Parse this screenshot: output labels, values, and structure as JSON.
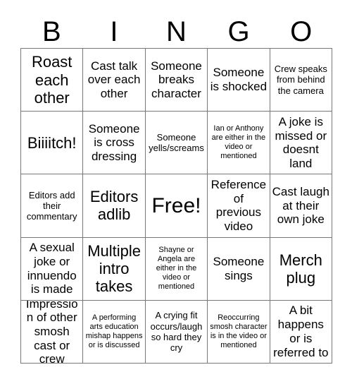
{
  "card": {
    "title": "BINGO",
    "header_letters": [
      "B",
      "I",
      "N",
      "G",
      "O"
    ],
    "columns": 5,
    "rows": 5,
    "border_color": "#777777",
    "text_color": "#000000",
    "background_color": "#ffffff",
    "free_space": {
      "row": 2,
      "col": 2,
      "label": "Free!"
    },
    "cells": [
      [
        {
          "text": "Roast each other",
          "size": "lg"
        },
        {
          "text": "Cast talk over each other",
          "size": "md"
        },
        {
          "text": "Someone breaks character",
          "size": "md"
        },
        {
          "text": "Someone is shocked",
          "size": "md"
        },
        {
          "text": "Crew speaks from behind the camera",
          "size": "sm"
        }
      ],
      [
        {
          "text": "Biiiitch!",
          "size": "lg"
        },
        {
          "text": "Someone is cross dressing",
          "size": "md"
        },
        {
          "text": "Someone yells/screams",
          "size": "sm"
        },
        {
          "text": "Ian or Anthony are either in the video or mentioned",
          "size": "xs"
        },
        {
          "text": "A joke is missed or doesnt land",
          "size": "md"
        }
      ],
      [
        {
          "text": "Editors add their commentary",
          "size": "sm"
        },
        {
          "text": "Editors adlib",
          "size": "lg"
        },
        {
          "text": "Free!",
          "size": "xl"
        },
        {
          "text": "Reference of previous video",
          "size": "md"
        },
        {
          "text": "Cast laugh at their own joke",
          "size": "md"
        }
      ],
      [
        {
          "text": "A sexual joke or innuendo is made",
          "size": "md"
        },
        {
          "text": "Multiple intro takes",
          "size": "lg"
        },
        {
          "text": "Shayne or Angela are either in the video or mentioned",
          "size": "xs"
        },
        {
          "text": "Someone sings",
          "size": "md"
        },
        {
          "text": "Merch plug",
          "size": "lg"
        }
      ],
      [
        {
          "text": "Impression of other smosh cast or crew",
          "size": "md"
        },
        {
          "text": "A performing arts education mishap happens or is discussed",
          "size": "xs"
        },
        {
          "text": "A crying fit occurs/laugh so hard they cry",
          "size": "sm"
        },
        {
          "text": "Reoccurring smosh character is in the video or mentioned",
          "size": "xs"
        },
        {
          "text": "A bit happens or is referred to",
          "size": "md"
        }
      ]
    ]
  }
}
